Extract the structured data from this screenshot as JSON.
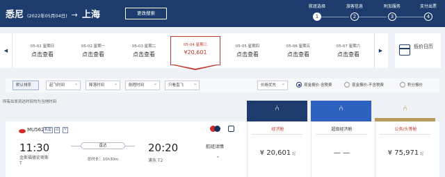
{
  "header": {
    "origin": "悉尼",
    "date": "(2022年05月04日)",
    "arrow": "→",
    "destination": "上海",
    "change_search": "更改搜索",
    "steps": [
      {
        "label": "航班选择",
        "num": "1"
      },
      {
        "label": "旅客信息",
        "num": "2"
      },
      {
        "label": "附加服务",
        "num": "3"
      },
      {
        "label": "支付出票",
        "num": "4"
      }
    ]
  },
  "date_strip": {
    "prev": "◀",
    "next": "▶",
    "days": [
      {
        "date": "05-01 星期日",
        "price": "点击查看"
      },
      {
        "date": "05-02 星期一",
        "price": "点击查看"
      },
      {
        "date": "05-03 星期二",
        "price": "点击查看"
      },
      {
        "date": "05-04 星期三",
        "price": "¥20,601"
      },
      {
        "date": "05-05 星期四",
        "price": "点击查看"
      },
      {
        "date": "05-06 星期五",
        "price": "点击查看"
      },
      {
        "date": "05-07 星期六",
        "price": "点击查看"
      }
    ],
    "low_price_calendar": "低价日历"
  },
  "filters": {
    "default_sort": "默认排序",
    "dropdowns": [
      "起飞时间",
      "降落时间",
      "航程时间",
      "只看直飞"
    ],
    "price_priority": "价格优先",
    "radios": [
      "现金报价-含税费",
      "现金报价-不含税费",
      "积分报价"
    ]
  },
  "note": "所有出发到达时间均为当地时间",
  "cabins": [
    {
      "name": "经济舱",
      "price": "¥ 20,601",
      "suffix": "起",
      "color": "#1d3c6d"
    },
    {
      "name": "超级经济舱",
      "price": "— —",
      "suffix": "",
      "color": "#2f62c0"
    },
    {
      "name": "公务/头等舱",
      "price": "¥ 75,971",
      "suffix": "起",
      "color": "#b89a5a"
    }
  ],
  "flight": {
    "number": "MU562",
    "tags": [
      "机型",
      "⊡",
      "♈"
    ],
    "dep_time": "11:30",
    "dep_airport": "金斯福德史密斯",
    "dep_terminal": "T",
    "direct": "直达",
    "duration": "总时长：10h30m",
    "arr_time": "20:20",
    "arr_airport": "浦东 T2",
    "detail": "航班详情",
    "chevron": "⌄"
  }
}
